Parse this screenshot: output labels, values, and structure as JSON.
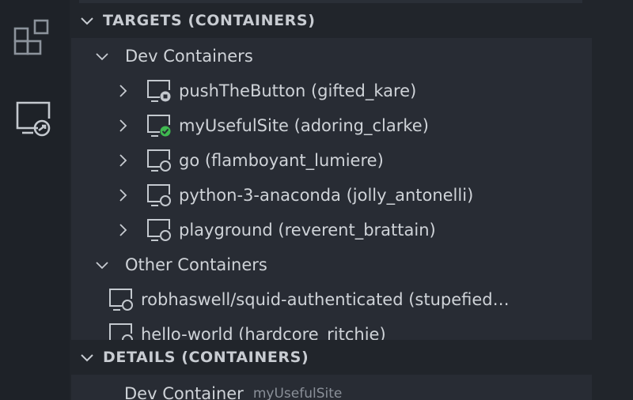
{
  "targets_header": "TARGETS (CONTAINERS)",
  "details_header": "DETAILS (CONTAINERS)",
  "dev_group": "Dev Containers",
  "other_group": "Other Containers",
  "dev_containers": [
    {
      "label": "pushTheButton (gifted_kare)",
      "status": "stopped"
    },
    {
      "label": "myUsefulSite (adoring_clarke)",
      "status": "running"
    },
    {
      "label": "go (flamboyant_lumiere)",
      "status": "none"
    },
    {
      "label": "python-3-anaconda (jolly_antonelli)",
      "status": "none"
    },
    {
      "label": "playground (reverent_brattain)",
      "status": "none"
    }
  ],
  "other_containers": [
    {
      "label": "robhaswell/squid-authenticated (stupefied…"
    },
    {
      "label": "hello-world (hardcore_ritchie)"
    }
  ],
  "details": {
    "label": "Dev Container",
    "value": "myUsefulSite"
  },
  "colors": {
    "running": "#3fb950",
    "background": "#21252b",
    "panel": "#282c34"
  },
  "icons": {
    "extensions": "extensions-icon",
    "remote_explorer": "remote-explorer-icon"
  }
}
